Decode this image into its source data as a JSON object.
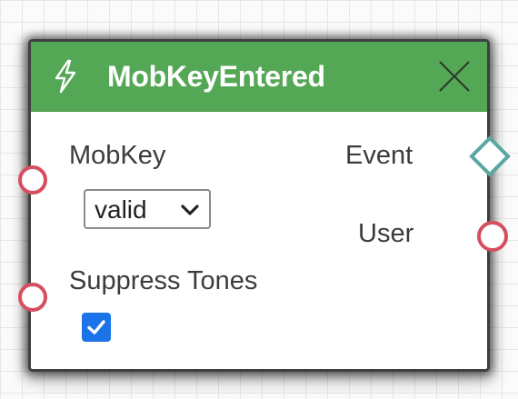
{
  "node": {
    "title": "MobKeyEntered",
    "header_icon": "lightning-bolt-icon",
    "close_icon": "close-icon",
    "header_color": "#54a855"
  },
  "inputs": {
    "mobkey": {
      "label": "MobKey",
      "selected_value": "valid"
    },
    "suppress_tones": {
      "label": "Suppress Tones",
      "checked": true
    }
  },
  "outputs": {
    "event": {
      "label": "Event"
    },
    "user": {
      "label": "User"
    }
  },
  "colors": {
    "port_circle": "#d64f60",
    "port_diamond": "#5aa6a0",
    "checkbox": "#1a73e8"
  }
}
